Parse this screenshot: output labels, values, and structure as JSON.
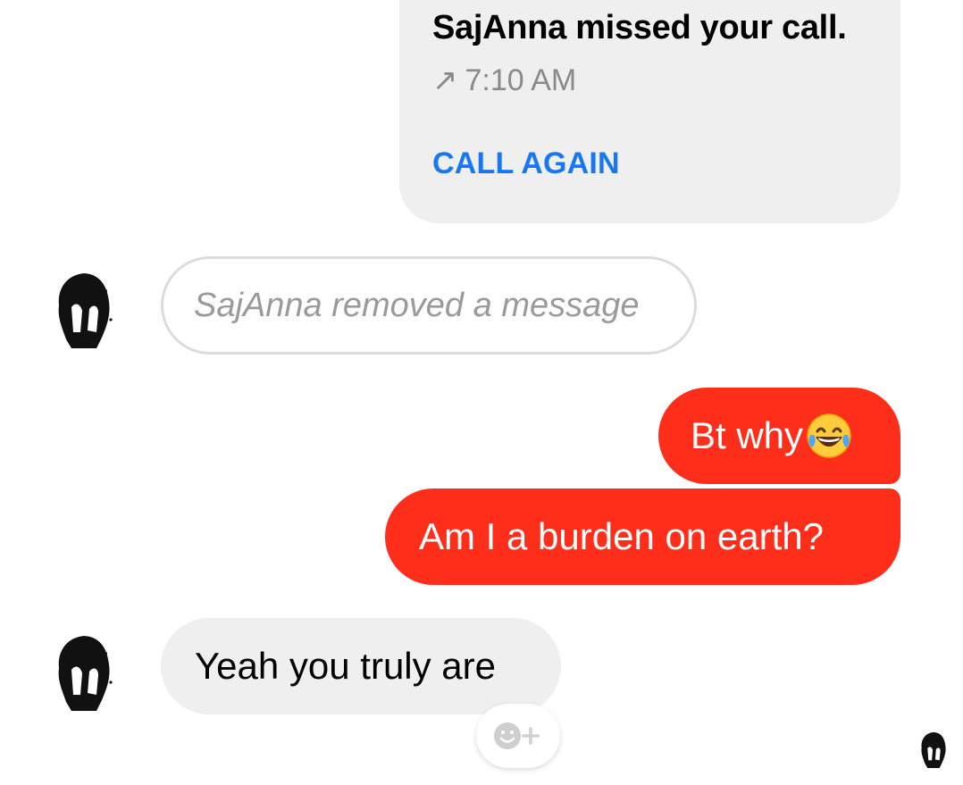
{
  "missed_call": {
    "title": "SajAnna missed your call.",
    "arrow_symbol": "↗",
    "time": "7:10 AM",
    "action_label": "CALL AGAIN"
  },
  "messages": {
    "removed_text": "SajAnna removed a message",
    "outgoing_1": "Bt why",
    "outgoing_1_emoji": "face-with-tears-of-joy",
    "outgoing_2": "Am I a burden on earth?",
    "incoming_1": "Yeah you truly are"
  },
  "colors": {
    "outgoing_bubble": "#ff2e1a",
    "incoming_bubble": "#efefef",
    "link_blue": "#1877f2",
    "muted_text": "#8a8a8a"
  },
  "icons": {
    "reaction": "add-reaction-icon",
    "avatar": "contact-avatar"
  }
}
